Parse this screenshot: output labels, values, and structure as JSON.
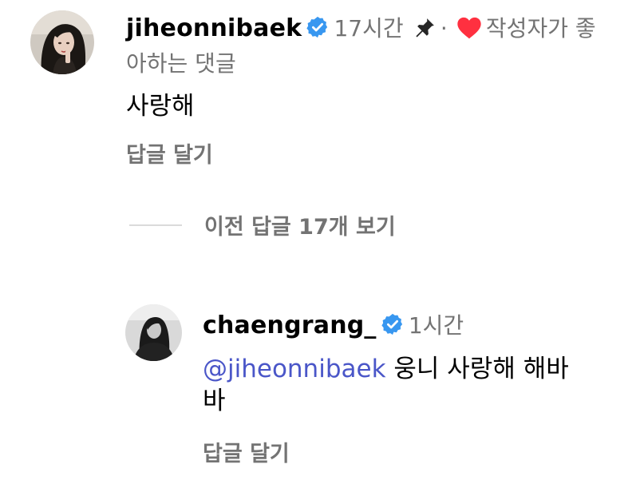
{
  "comment1": {
    "username": "jiheonnibaek",
    "time": "17시간",
    "separator": "·",
    "liked_by_author": "작성자가 좋",
    "liked_by_author_cont": "아하는 댓글",
    "text": "사랑해",
    "reply_label": "답글 달기",
    "icons": [
      "verified-badge-icon",
      "pin-icon",
      "heart-icon"
    ]
  },
  "view_previous": {
    "label": "이전 답글 17개 보기"
  },
  "comment2": {
    "username": "chaengrang_",
    "time": "1시간",
    "mention": "@jiheonnibaek",
    "text_line1": " 웅니 사랑해 해바",
    "text_line2": "바",
    "reply_label": "답글 달기",
    "icons": [
      "verified-badge-icon"
    ]
  },
  "colors": {
    "verified_blue": "#3897f0",
    "heart_red": "#ff3040",
    "mention_blue": "#4a56c8",
    "meta_gray": "#737373"
  }
}
